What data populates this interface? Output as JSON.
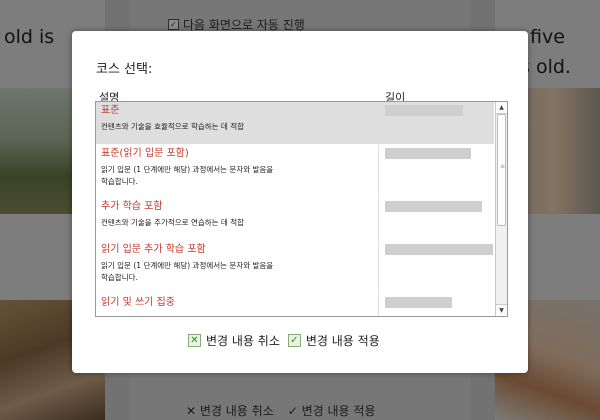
{
  "background": {
    "left_text": "old is",
    "right_text_line1": "five",
    "right_text_line2": "s old.",
    "auto_advance_label": "다음 화면으로 자동 진행",
    "cancel_label": "변경 내용 취소",
    "apply_label": "변경 내용 적용"
  },
  "dialog": {
    "title": "코스 선택:",
    "columns": {
      "description": "설명",
      "length": "길이"
    },
    "courses": [
      {
        "title": "표준",
        "description": "컨텐츠와 기술을 효율적으로 학습하는 데 적합",
        "length_fraction": 0.72,
        "selected": true
      },
      {
        "title": "표준(읽기 입문 포함)",
        "description": "읽기 입문 (1 단계에만 해당) 과정에서는 문자와 발음을\n학습합니다.",
        "length_fraction": 0.8,
        "selected": false
      },
      {
        "title": "추가 학습 포함",
        "description": "컨텐츠와 기술을 추가적으로 연습하는 데 적합",
        "length_fraction": 0.9,
        "selected": false
      },
      {
        "title": "읽기 입문 추가 학습 포함",
        "description": "읽기 입문 (1 단계에만 해당) 과정에서는 문자와 발음을\n학습합니다.",
        "length_fraction": 1.0,
        "selected": false
      },
      {
        "title": "읽기 및 쓰기 집중",
        "description": "",
        "length_fraction": 0.62,
        "selected": false
      }
    ],
    "cancel_label": "변경 내용 취소",
    "apply_label": "변경 내용 적용"
  },
  "icons": {
    "cancel": "x-icon",
    "apply": "check-icon",
    "scroll_up": "arrow-up-icon",
    "scroll_down": "arrow-down-icon"
  },
  "colors": {
    "course_title": "#c0392b",
    "selected_row": "#dedede",
    "length_bar": "#cfcfcf",
    "button_icon": "#2f8a2f"
  }
}
